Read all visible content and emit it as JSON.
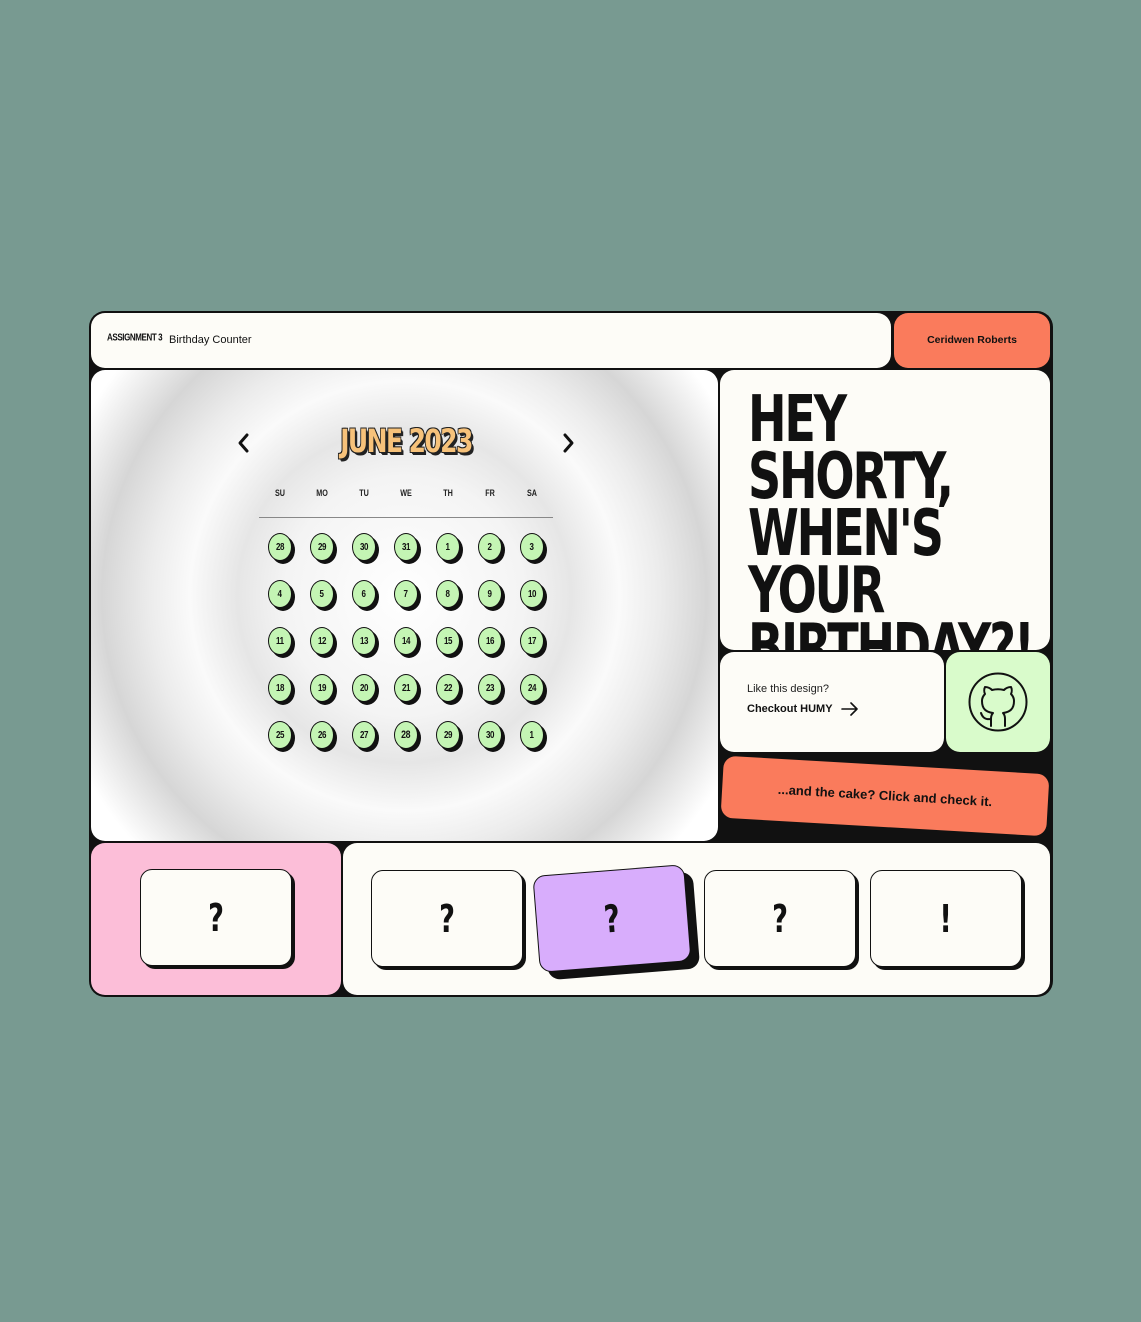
{
  "header": {
    "assignment": "ASSIGNMENT 3",
    "title": "Birthday Counter",
    "user": "Ceridwen Roberts"
  },
  "calendar": {
    "month_title": "JUNE 2023",
    "weekdays": [
      "SU",
      "MO",
      "TU",
      "WE",
      "TH",
      "FR",
      "SA"
    ],
    "weeks": [
      [
        "28",
        "29",
        "30",
        "31",
        "1",
        "2",
        "3"
      ],
      [
        "4",
        "5",
        "6",
        "7",
        "8",
        "9",
        "10"
      ],
      [
        "11",
        "12",
        "13",
        "14",
        "15",
        "16",
        "17"
      ],
      [
        "18",
        "19",
        "20",
        "21",
        "22",
        "23",
        "24"
      ],
      [
        "25",
        "26",
        "27",
        "28",
        "29",
        "30",
        "1"
      ]
    ],
    "coin_color": "#c4f5b4",
    "title_color": "#f7c27a"
  },
  "hero": {
    "headline": "HEY SHORTY, WHEN'S YOUR BIRTHDAY?!"
  },
  "design_promo": {
    "question": "Like this design?",
    "link": "Checkout HUMY"
  },
  "github": {
    "icon": "github-icon"
  },
  "cake_banner": "...and the cake? Click and check it.",
  "cards": {
    "pink_card": "?",
    "row": [
      "?",
      "?",
      "?",
      "!"
    ]
  },
  "colors": {
    "background": "#789a91",
    "accent_orange": "#fa7b5c",
    "accent_green": "#d9fbcb",
    "accent_pink": "#fcbed8",
    "accent_purple": "#d8adfc",
    "cream": "#fdfcf7"
  }
}
